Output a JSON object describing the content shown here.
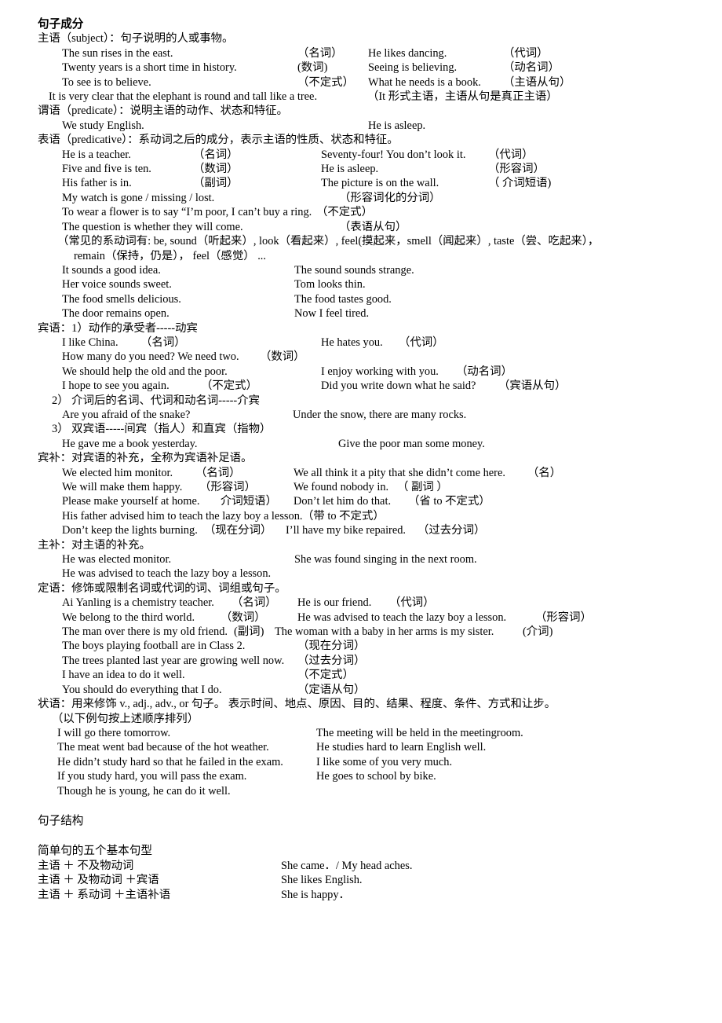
{
  "document": {
    "title": "句子成分",
    "sections": [
      {
        "id": "subject",
        "heading": "主语（subject）：句子说明的人或事物。",
        "lines": [
          {
            "indent": "ex",
            "left": "The sun rises in the east.",
            "leftTag": "（名词）",
            "right": "He likes dancing.",
            "rightTag": "（代词）"
          },
          {
            "indent": "ex",
            "left": "Twenty years is a short time in history.",
            "leftTag": "(数词)",
            "right": "Seeing is believing.",
            "rightTag": "（动名词）"
          },
          {
            "indent": "ex",
            "left": "To see is to believe.",
            "leftTag": "（不定式）",
            "right": "What he needs is a book.",
            "rightTag": "（主语从句）"
          },
          {
            "indent": "ex0",
            "left": "It is very clear that the elephant is round and tall like a tree.",
            "leftTag": "",
            "right": "（It 形式主语，主语从句是真正主语）",
            "rightTag": ""
          }
        ]
      },
      {
        "id": "predicate",
        "heading": "谓语（predicate）：说明主语的动作、状态和特征。",
        "lines": [
          {
            "indent": "ex",
            "left": "We study English.",
            "leftTag": "",
            "right": "He is asleep.",
            "rightTag": ""
          }
        ]
      },
      {
        "id": "predicative",
        "heading": "表语（predicative）：系动词之后的成分，表示主语的性质、状态和特征。",
        "lines": [
          {
            "indent": "ex",
            "left": "He is a teacher.",
            "leftTag": "（名词）",
            "right": "Seventy-four! You don’t look it.",
            "rightTag": "（代词）"
          },
          {
            "indent": "ex",
            "left": "Five and five is ten.",
            "leftTag": "（数词）",
            "right": "He is asleep.",
            "rightTag": "（形容词）"
          },
          {
            "indent": "ex",
            "left": "His father is in.",
            "leftTag": "（副词）",
            "right": "The picture is on the wall.",
            "rightTag": "（ 介词短语)"
          },
          {
            "indent": "ex",
            "left": "My watch is gone / missing / lost.",
            "leftTag": "",
            "right": "（形容词化的分词）",
            "rightTag": ""
          },
          {
            "indent": "ex",
            "left": "To wear a flower is to say “I’m poor, I can’t buy a ring.",
            "leftTag": "（不定式）",
            "right": "",
            "rightTag": ""
          },
          {
            "indent": "ex",
            "left": "The question is whether they will come.",
            "leftTag": "",
            "right": "（表语从句）",
            "rightTag": ""
          }
        ],
        "note_lines": [
          "（常见的系动词有: be, sound（听起来）, look（看起来）, feel(摸起来，smell（闻起来）, taste（尝、吃起来），",
          "remain（保持，仍是）， feel（感觉） ..."
        ],
        "extra_lines": [
          {
            "indent": "ex",
            "left": "It sounds a good idea.",
            "leftTag": "",
            "right": "The sound sounds strange.",
            "rightTag": ""
          },
          {
            "indent": "ex",
            "left": "Her voice sounds sweet.",
            "leftTag": "",
            "right": "Tom looks thin.",
            "rightTag": ""
          },
          {
            "indent": "ex",
            "left": "The food smells delicious.",
            "leftTag": "",
            "right": "The food tastes good.",
            "rightTag": ""
          },
          {
            "indent": "ex",
            "left": "The door remains open.",
            "leftTag": "",
            "right": "Now I feel tired.",
            "rightTag": ""
          }
        ]
      },
      {
        "id": "object",
        "heading": "宾语：1）动作的承受者-----动宾",
        "lines": [
          {
            "indent": "ex",
            "left": "I like China.",
            "leftTag": "（名词）",
            "right": "He hates you.",
            "rightTag": "（代词）"
          },
          {
            "indent": "ex",
            "left": "How many do you need? We need two.",
            "leftTag": "（数词）",
            "right": "",
            "rightTag": ""
          },
          {
            "indent": "ex",
            "left": "We should help the old and the poor.",
            "leftTag": "",
            "right": "I enjoy working with you.",
            "rightTag": "（动名词）"
          },
          {
            "indent": "ex",
            "left": "I hope to see you again.",
            "leftTag": "（不定式）",
            "right": "Did you write down what he said?",
            "rightTag": "（宾语从句）"
          }
        ],
        "sub2_heading": "2）  介词后的名词、代词和动名词-----介宾",
        "sub2_lines": [
          {
            "indent": "ex",
            "left": "Are you afraid of the snake?",
            "leftTag": "",
            "right": "Under the snow, there are many rocks.",
            "rightTag": ""
          }
        ],
        "sub3_heading": "3）  双宾语-----间宾（指人）和直宾（指物）",
        "sub3_lines": [
          {
            "indent": "ex",
            "left": "He gave me a book yesterday.",
            "leftTag": "",
            "right": "Give the poor man some money.",
            "rightTag": ""
          }
        ]
      },
      {
        "id": "object-complement",
        "heading": "宾补：对宾语的补充，全称为宾语补足语。",
        "lines": [
          {
            "indent": "ex",
            "left": "We elected him monitor.",
            "leftTag": "（名词）",
            "right": "We all think it a pity that she didn’t come here.",
            "rightTag": "（名）"
          },
          {
            "indent": "ex",
            "left": "We will make them happy.",
            "leftTag": "（形容词）",
            "right": "We found nobody in.",
            "rightTag": "（ 副词 ）"
          },
          {
            "indent": "ex",
            "left": "Please make yourself at home.",
            "leftTag": "介词短语）",
            "right": "Don’t let him do that.",
            "rightTag": "（省 to 不定式）"
          },
          {
            "indent": "ex",
            "left": "His father advised him to teach the lazy boy a lesson.",
            "leftTag": "（带 to 不定式）",
            "right": "",
            "rightTag": ""
          },
          {
            "indent": "ex",
            "left": "Don’t keep the lights burning.",
            "leftTag": "（现在分词）",
            "right": "I’ll have my bike repaired.",
            "rightTag": "（过去分词）"
          }
        ]
      },
      {
        "id": "subject-complement",
        "heading": "主补：对主语的补充。",
        "lines": [
          {
            "indent": "ex",
            "left": "He was elected monitor.",
            "leftTag": "",
            "right": "She was found singing in the next room.",
            "rightTag": ""
          },
          {
            "indent": "ex",
            "left": "He was advised to teach the lazy boy a lesson.",
            "leftTag": "",
            "right": "",
            "rightTag": ""
          }
        ]
      },
      {
        "id": "attributive",
        "heading": "定语：修饰或限制名词或代词的词、词组或句子。",
        "lines": [
          {
            "indent": "ex",
            "left": "Ai Yanling is a chemistry teacher.",
            "leftTag": "（名词）",
            "right": "He is our friend.",
            "rightTag": "（代词）"
          },
          {
            "indent": "ex",
            "left": "We belong to the third world.",
            "leftTag": "（数词）",
            "right": "He was advised to teach the lazy boy a lesson.",
            "rightTag": "（形容词）"
          },
          {
            "indent": "ex",
            "left": "The man over there is my old friend.",
            "leftTag": "(副词)",
            "right": "The woman with a baby in her arms is my sister.",
            "rightTag": "(介词)"
          },
          {
            "indent": "ex",
            "left": "The boys playing football are in Class 2.",
            "leftTag": "",
            "right": "（现在分词）",
            "rightTag": ""
          },
          {
            "indent": "ex",
            "left": "The trees planted last year are growing well now.",
            "leftTag": "",
            "right": "（过去分词）",
            "rightTag": ""
          },
          {
            "indent": "ex",
            "left": "I have an idea to do it well.",
            "leftTag": "",
            "right": "（不定式）",
            "rightTag": ""
          },
          {
            "indent": "ex",
            "left": "You should do everything that I do.",
            "leftTag": "",
            "right": "（定语从句）",
            "rightTag": ""
          }
        ]
      },
      {
        "id": "adverbial",
        "heading": "状语：用来修饰 v., adj., adv., or 句子。 表示时间、地点、原因、目的、结果、程度、条件、方式和让步。",
        "subnote": "（以下例句按上述顺序排列）",
        "lines": [
          {
            "indent": "ex2",
            "left": "I will go there tomorrow.",
            "leftTag": "",
            "right": "The meeting will be held in the meetingroom.",
            "rightTag": ""
          },
          {
            "indent": "ex2",
            "left": "The meat went bad because of the hot weather.",
            "leftTag": "",
            "right": "He studies hard to learn English well.",
            "rightTag": ""
          },
          {
            "indent": "ex2",
            "left": "He didn’t study hard so that he failed in the exam.",
            "leftTag": "",
            "right": "I like some of you very much.",
            "rightTag": ""
          },
          {
            "indent": "ex2",
            "left": "If you study hard, you will pass the exam.",
            "leftTag": "",
            "right": "He goes to school by bike.",
            "rightTag": ""
          },
          {
            "indent": "ex2",
            "left": "Though he is young, he can do it well.",
            "leftTag": "",
            "right": "",
            "rightTag": ""
          }
        ]
      }
    ],
    "structure": {
      "title": "句子结构",
      "subtitle": "简单句的五个基本句型",
      "patterns": [
        {
          "pattern": "主语 ＋ 不及物动词",
          "example": "She came．/ My head aches."
        },
        {
          "pattern": "主语 ＋ 及物动词 ＋宾语",
          "example": "She likes English."
        },
        {
          "pattern": "主语 ＋ 系动词    ＋主语补语",
          "example": "She is happy．"
        }
      ]
    }
  }
}
